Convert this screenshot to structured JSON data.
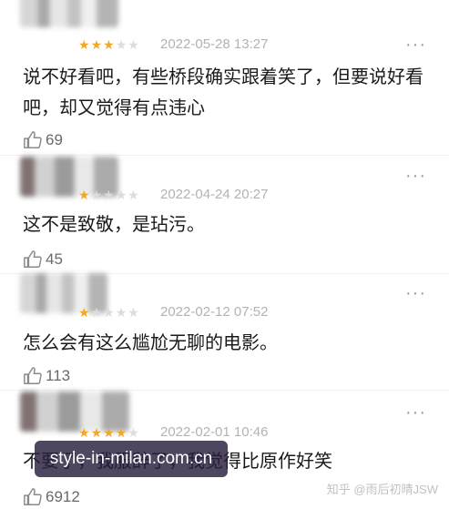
{
  "reviews": [
    {
      "rating": 3,
      "time": "2022-05-28 13:27",
      "text": "说不好看吧，有些桥段确实跟着笑了，但要说好看吧，却又觉得有点违心",
      "likes": "69"
    },
    {
      "rating": 1,
      "time": "2022-04-24 20:27",
      "text": "这不是致敬，是玷污。",
      "likes": "45"
    },
    {
      "rating": 1,
      "time": "2022-02-12 07:52",
      "text": "怎么会有这么尴尬无聊的电影。",
      "likes": "113"
    },
    {
      "rating": 4,
      "time": "2022-02-01 10:46",
      "text": "不要了，我服辞了，我觉得比原作好笑",
      "likes": "6912"
    }
  ],
  "more_glyph": "···",
  "overlay_watermark": "style-in-milan.com.cn",
  "source_watermark": "知乎 @雨后初晴JSW",
  "colors": {
    "star_on": "#f5a623",
    "star_off": "#dcdcdc",
    "time": "#b3b3b3",
    "like_icon": "#8a8a8a"
  },
  "icons": {
    "like": "thumbs-up-icon",
    "more": "more-dots-icon"
  }
}
